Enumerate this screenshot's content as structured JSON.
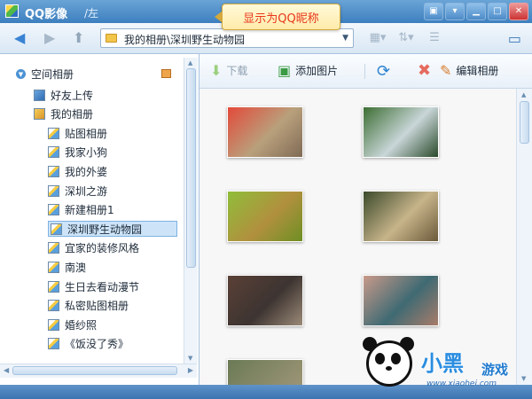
{
  "titlebar": {
    "app_title": "QQ影像",
    "path_title": "/左"
  },
  "tooltip": {
    "text": "显示为QQ昵称"
  },
  "toolbar": {
    "address": "我的相册\\深圳野生动物园"
  },
  "sidebar": {
    "header": "空间相册",
    "items": [
      {
        "label": "好友上传",
        "indent": 1,
        "type": "friends"
      },
      {
        "label": "我的相册",
        "indent": 1,
        "type": "album"
      },
      {
        "label": "贴图相册",
        "indent": 2
      },
      {
        "label": "我家小狗",
        "indent": 2
      },
      {
        "label": "我的外婆",
        "indent": 2
      },
      {
        "label": "深圳之游",
        "indent": 2
      },
      {
        "label": "新建相册1",
        "indent": 2
      },
      {
        "label": "深圳野生动物园",
        "indent": 2,
        "selected": true
      },
      {
        "label": "宜家的装修风格",
        "indent": 2
      },
      {
        "label": "南澳",
        "indent": 2
      },
      {
        "label": "生日去看动漫节",
        "indent": 2
      },
      {
        "label": "私密贴图相册",
        "indent": 2
      },
      {
        "label": "婚纱照",
        "indent": 2
      },
      {
        "label": "《饭没了秀》",
        "indent": 2
      }
    ]
  },
  "content_toolbar": {
    "download": "下载",
    "add_picture": "添加图片",
    "edit_album": "编辑相册"
  },
  "photos": [
    {
      "colors": [
        "#e34a3a",
        "#b9a07c",
        "#7f6a55"
      ]
    },
    {
      "colors": [
        "#3d6e33",
        "#c9d6d8",
        "#2a4a2b"
      ]
    },
    {
      "colors": [
        "#8fbe3a",
        "#b1903e",
        "#6e8f23"
      ]
    },
    {
      "colors": [
        "#3b4a2b",
        "#c7b48a",
        "#6b5a3a"
      ]
    },
    {
      "colors": [
        "#5a4036",
        "#3d3431",
        "#9b8a78"
      ]
    },
    {
      "colors": [
        "#c99a8a",
        "#3f6a73",
        "#a87c6a"
      ]
    }
  ],
  "logo": {
    "text": "小黑",
    "game": "游戏",
    "url": "www.xiaohei.com"
  }
}
